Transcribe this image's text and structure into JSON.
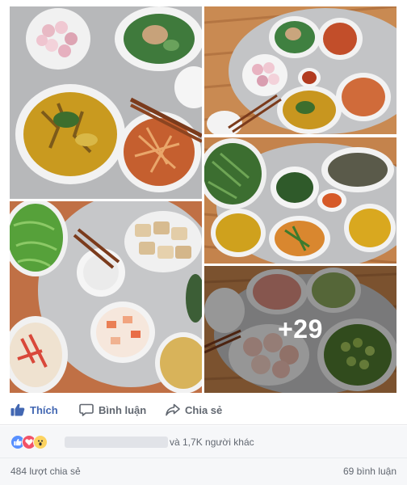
{
  "post": {
    "more_photos_label": "+29"
  },
  "actions": {
    "like_label": "Thích",
    "comment_label": "Bình luận",
    "share_label": "Chia sẻ"
  },
  "reactions": {
    "icons": [
      "like-icon",
      "love-icon",
      "wow-icon"
    ],
    "summary_text": "và 1,7K người khác"
  },
  "stats": {
    "shares_text": "484 lượt chia sẻ",
    "comments_text": "69 bình luận"
  },
  "colors": {
    "link_blue": "#4267b2",
    "secondary_text": "#616770",
    "tray_silver": "#c9cacc",
    "mat_orange": "#c06a3a"
  }
}
